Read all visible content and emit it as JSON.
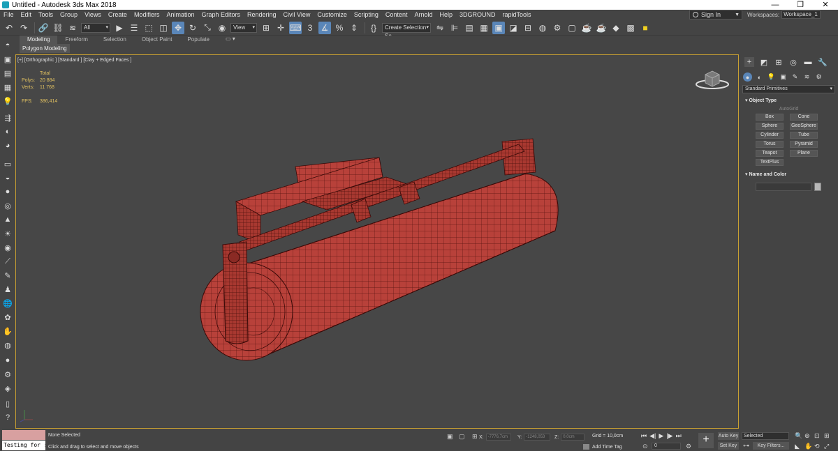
{
  "window": {
    "title": "Untitled - Autodesk 3ds Max 2018",
    "controls": [
      "—",
      "❐",
      "✕"
    ]
  },
  "menu": [
    "File",
    "Edit",
    "Tools",
    "Group",
    "Views",
    "Create",
    "Modifiers",
    "Animation",
    "Graph Editors",
    "Rendering",
    "Civil View",
    "Customize",
    "Scripting",
    "Content",
    "Arnold",
    "Help",
    "3DGROUND",
    "rapidTools"
  ],
  "account": {
    "signin": "Sign In"
  },
  "workspaces": {
    "label": "Workspaces:",
    "value": "Workspace_1"
  },
  "toolbar": {
    "selection_filter": "All",
    "reference_coord": "View",
    "snap_label": "3",
    "named_selection": "Create Selection Se"
  },
  "ribbon": {
    "tabs": [
      "Modeling",
      "Freeform",
      "Selection",
      "Object Paint",
      "Populate"
    ],
    "active_tab": "Modeling",
    "subtab": "Polygon Modeling"
  },
  "viewport": {
    "label": "[+] [Orthographic ] [Standard ] [Clay + Edged Faces ]",
    "stats": {
      "header": "Total",
      "polys_label": "Polys:",
      "polys": "20 884",
      "verts_label": "Verts:",
      "verts": "11 768",
      "fps_label": "FPS:",
      "fps": "386,414"
    },
    "model_color": "#b8413a",
    "wire_color": "#5a1410"
  },
  "command_panel": {
    "category": "Standard Primitives",
    "object_type_header": "Object Type",
    "autogrid": "AutoGrid",
    "primitives": [
      "Box",
      "Cone",
      "Sphere",
      "GeoSphere",
      "Cylinder",
      "Tube",
      "Torus",
      "Pyramid",
      "Teapot",
      "Plane",
      "TextPlus"
    ],
    "name_color_header": "Name and Color"
  },
  "status": {
    "script_input": "Testing for :",
    "selection": "None Selected",
    "prompt": "Click and drag to select and move objects",
    "x_label": "X:",
    "x": "-7776,7cm",
    "y_label": "Y:",
    "y": "-1248,053",
    "z_label": "Z:",
    "z": "0,0cm",
    "grid": "Grid = 10,0cm",
    "add_time_tag": "Add Time Tag",
    "frame": "0",
    "auto_key": "Auto Key",
    "set_key": "Set Key",
    "selected": "Selected",
    "key_filters": "Key Filters..."
  }
}
